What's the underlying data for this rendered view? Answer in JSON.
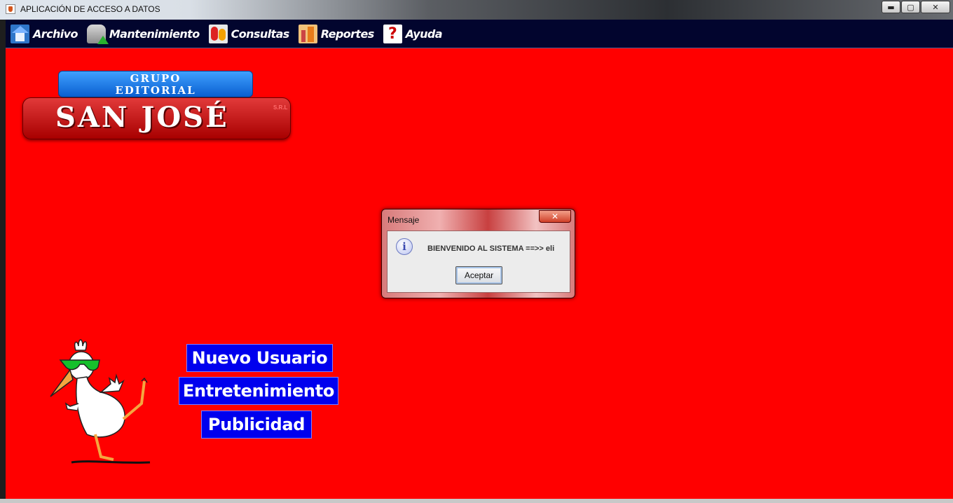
{
  "window": {
    "title": "APLICACIÓN DE ACCESO A DATOS",
    "minimize_glyph": "▬",
    "maximize_glyph": "▢",
    "close_glyph": "✕"
  },
  "menu": {
    "items": [
      {
        "label": "Archivo",
        "icon": "home-icon"
      },
      {
        "label": "Mantenimiento",
        "icon": "database-upload-icon"
      },
      {
        "label": "Consultas",
        "icon": "people-icon"
      },
      {
        "label": "Reportes",
        "icon": "report-building-icon"
      },
      {
        "label": "Ayuda",
        "icon": "help-icon"
      }
    ],
    "help_glyph": "?"
  },
  "logo": {
    "line1": "GRUPO",
    "line2": "EDITORIAL",
    "name": "SAN JOSÉ",
    "suffix": "S.R.L"
  },
  "dialog": {
    "title": "Mensaje",
    "close_glyph": "✕",
    "info_glyph": "i",
    "message": "BIENVENIDO AL SISTEMA ==>> eli",
    "ok_label": "Aceptar"
  },
  "buttons": {
    "new_user": "Nuevo Usuario",
    "entertainment": "Entretenimiento",
    "advertising": "Publicidad"
  },
  "colors": {
    "background": "#ff0000",
    "menubar": "#02052e",
    "button": "#0000ee"
  }
}
